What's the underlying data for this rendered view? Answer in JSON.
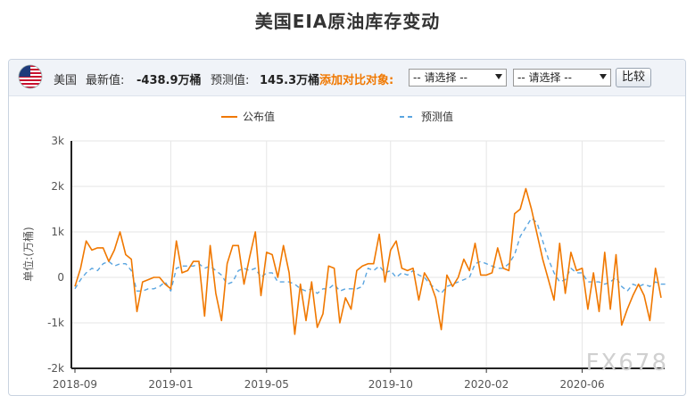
{
  "title": "美国EIA原油库存变动",
  "toolbar": {
    "country": "美国",
    "latest_label": "最新值:",
    "latest_value": "-438.9万桶",
    "forecast_label": "预测值:",
    "forecast_value": "145.3万桶",
    "compare_label": "添加对比对象:",
    "select1": "-- 请选择 --",
    "select2": "-- 请选择 --",
    "compare_button": "比较",
    "flag_icon": "us-flag-icon"
  },
  "watermark": "FX678",
  "chart_data": {
    "type": "line",
    "ylabel": "单位:(万桶)",
    "ylim": [
      -2000,
      3000
    ],
    "yticks": [
      -2000,
      -1000,
      0,
      1000,
      2000,
      3000
    ],
    "ytick_labels": [
      "-2k",
      "-1k",
      "0",
      "1k",
      "2k",
      "3k"
    ],
    "xtick_labels": [
      "2018-09",
      "2019-01",
      "2019-05",
      "2019-10",
      "2020-02",
      "2020-06"
    ],
    "grid": true,
    "legend_position": "top",
    "series": [
      {
        "name": "公布值",
        "color": "#f07800",
        "style": "solid",
        "values": [
          -200,
          200,
          800,
          600,
          650,
          650,
          350,
          600,
          1000,
          500,
          400,
          -750,
          -100,
          -50,
          0,
          0,
          -150,
          -250,
          800,
          100,
          150,
          350,
          350,
          -850,
          700,
          -350,
          -950,
          300,
          700,
          700,
          -150,
          450,
          1000,
          -400,
          550,
          500,
          0,
          700,
          100,
          -1250,
          -150,
          -950,
          -100,
          -1100,
          -800,
          250,
          200,
          -1000,
          -450,
          -700,
          150,
          250,
          300,
          300,
          950,
          -100,
          600,
          800,
          200,
          150,
          200,
          -500,
          100,
          -100,
          -450,
          -1150,
          50,
          -200,
          0,
          400,
          150,
          750,
          50,
          50,
          100,
          650,
          200,
          150,
          1400,
          1500,
          1950,
          1500,
          950,
          400,
          -50,
          -500,
          750,
          -350,
          550,
          150,
          200,
          -700,
          100,
          -750,
          550,
          -700,
          500,
          -1050,
          -700,
          -400,
          -150,
          -400,
          -950,
          200,
          -450
        ],
        "values_note": "x-index spans 2018-09 to 2020-08, weekly"
      },
      {
        "name": "预测值",
        "color": "#5aa5e0",
        "style": "dashed",
        "values": [
          -250,
          -50,
          100,
          200,
          150,
          300,
          350,
          250,
          300,
          300,
          150,
          -300,
          -300,
          -250,
          -250,
          -200,
          -100,
          -300,
          200,
          250,
          250,
          250,
          300,
          200,
          250,
          150,
          50,
          -150,
          -100,
          150,
          200,
          150,
          200,
          0,
          100,
          100,
          -100,
          -100,
          -100,
          -150,
          -250,
          -300,
          -250,
          -350,
          -250,
          -250,
          -150,
          -300,
          -250,
          -250,
          -250,
          -200,
          200,
          150,
          250,
          100,
          150,
          0,
          100,
          50,
          150,
          50,
          0,
          -150,
          -250,
          -350,
          -200,
          -150,
          -100,
          -50,
          0,
          300,
          350,
          300,
          250,
          200,
          200,
          300,
          500,
          900,
          1100,
          1300,
          1200,
          800,
          400,
          100,
          -100,
          -50,
          200,
          100,
          100,
          -100,
          -100,
          -100,
          -150,
          -100,
          0,
          -200,
          -300,
          -150,
          -200,
          -150,
          -200,
          -100,
          -150,
          -150
        ]
      }
    ]
  }
}
